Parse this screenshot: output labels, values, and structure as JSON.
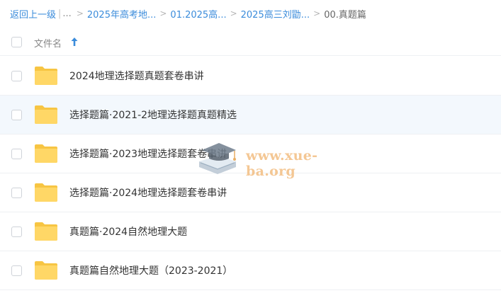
{
  "breadcrumb": {
    "back": "返回上一级",
    "pipe": "|",
    "ellipsis": "...",
    "separator": ">",
    "crumbs": [
      "2025年高考地...",
      "01.2025高...",
      "2025高三刘勖..."
    ],
    "current": "00.真题篇"
  },
  "list_header": {
    "name_label": "文件名",
    "sort_icon": "arrow-up-icon"
  },
  "files": [
    {
      "name": "2024地理选择题真题套卷串讲",
      "icon": "folder-icon"
    },
    {
      "name": "选择题篇·2021-2地理选择题真题精选",
      "icon": "folder-icon"
    },
    {
      "name": "选择题篇·2023地理选择题套卷串讲",
      "icon": "folder-icon"
    },
    {
      "name": "选择题篇·2024地理选择题套卷串讲",
      "icon": "folder-icon"
    },
    {
      "name": "真题篇·2024自然地理大题",
      "icon": "folder-icon"
    },
    {
      "name": "真题篇自然地理大题（2023-2021）",
      "icon": "folder-icon"
    }
  ],
  "watermark": {
    "text": "www.xue-ba.org"
  },
  "colors": {
    "link": "#3b8cdb",
    "folder": "#ffd35c",
    "row_hover": "#f3f8fd",
    "watermark": "#f1b877"
  }
}
